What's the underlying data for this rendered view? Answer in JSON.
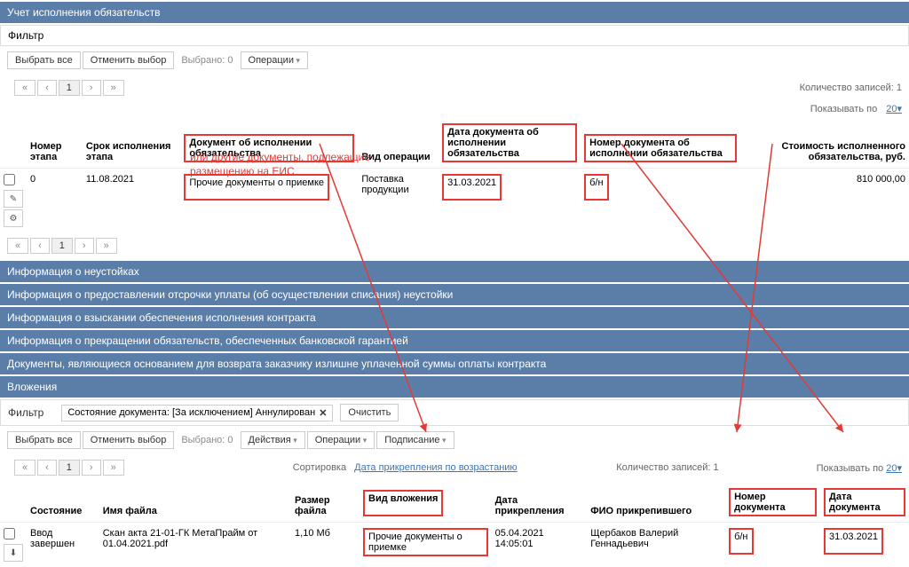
{
  "section1": {
    "title": "Учет исполнения обязательств",
    "filter_label": "Фильтр",
    "btn_select_all": "Выбрать все",
    "btn_deselect": "Отменить выбор",
    "selected": "Выбрано: 0",
    "operations": "Операции",
    "records": "Количество записей: 1",
    "show_per": "Показывать по",
    "show_per_n": "20",
    "headers": {
      "stage": "Номер этапа",
      "due": "Срок исполнения этапа",
      "doc": "Документ об исполнении обязательства",
      "op": "Вид операции",
      "doc_date": "Дата документа об исполнении обязательства",
      "doc_num": "Номер документа об исполнении обязательства",
      "cost": "Стоимость исполненного обязательства, руб."
    },
    "row": {
      "stage": "0",
      "due": "11.08.2021",
      "doc": "Прочие документы о приемке",
      "op": "Поставка продукции",
      "doc_date": "31.03.2021",
      "doc_num": "б/н",
      "cost": "810 000,00"
    },
    "annotation_l1": "или другие документы, подлежащие",
    "annotation_l2": "размещению на ЕИС"
  },
  "accordions": [
    "Информация о неустойках",
    "Информация о предоставлении отсрочки уплаты (об осуществлении списания) неустойки",
    "Информация о взыскании обеспечения исполнения контракта",
    "Информация о прекращении обязательств, обеспеченных банковской гарантией",
    "Документы, являющиеся основанием для возврата заказчику излишне уплаченной суммы оплаты контракта"
  ],
  "section2": {
    "title": "Вложения",
    "filter_label": "Фильтр",
    "chip_text": "Состояние документа: [За исключением] Аннулирован",
    "clear": "Очистить",
    "btn_select_all": "Выбрать все",
    "btn_deselect": "Отменить выбор",
    "selected": "Выбрано: 0",
    "actions": "Действия",
    "operations": "Операции",
    "signing": "Подписание",
    "sort_label": "Сортировка",
    "sort_value": "Дата прикрепления по возрастанию",
    "records": "Количество записей: 1",
    "show_per": "Показывать по",
    "show_per_n": "20",
    "headers": {
      "state": "Состояние",
      "filename": "Имя файла",
      "filesize": "Размер файла",
      "att_type": "Вид вложения",
      "att_date": "Дата прикрепления",
      "user": "ФИО прикрепившего",
      "doc_num": "Номер документа",
      "doc_date": "Дата документа"
    },
    "row": {
      "state": "Ввод завершен",
      "filename": "Скан акта 21-01-ГК МетаПрайм от 01.04.2021.pdf",
      "filesize": "1,10 Мб",
      "att_type": "Прочие документы о приемке",
      "att_date": "05.04.2021 14:05:01",
      "user": "Щербаков Валерий Геннадьевич",
      "doc_num": "б/н",
      "doc_date": "31.03.2021"
    }
  }
}
